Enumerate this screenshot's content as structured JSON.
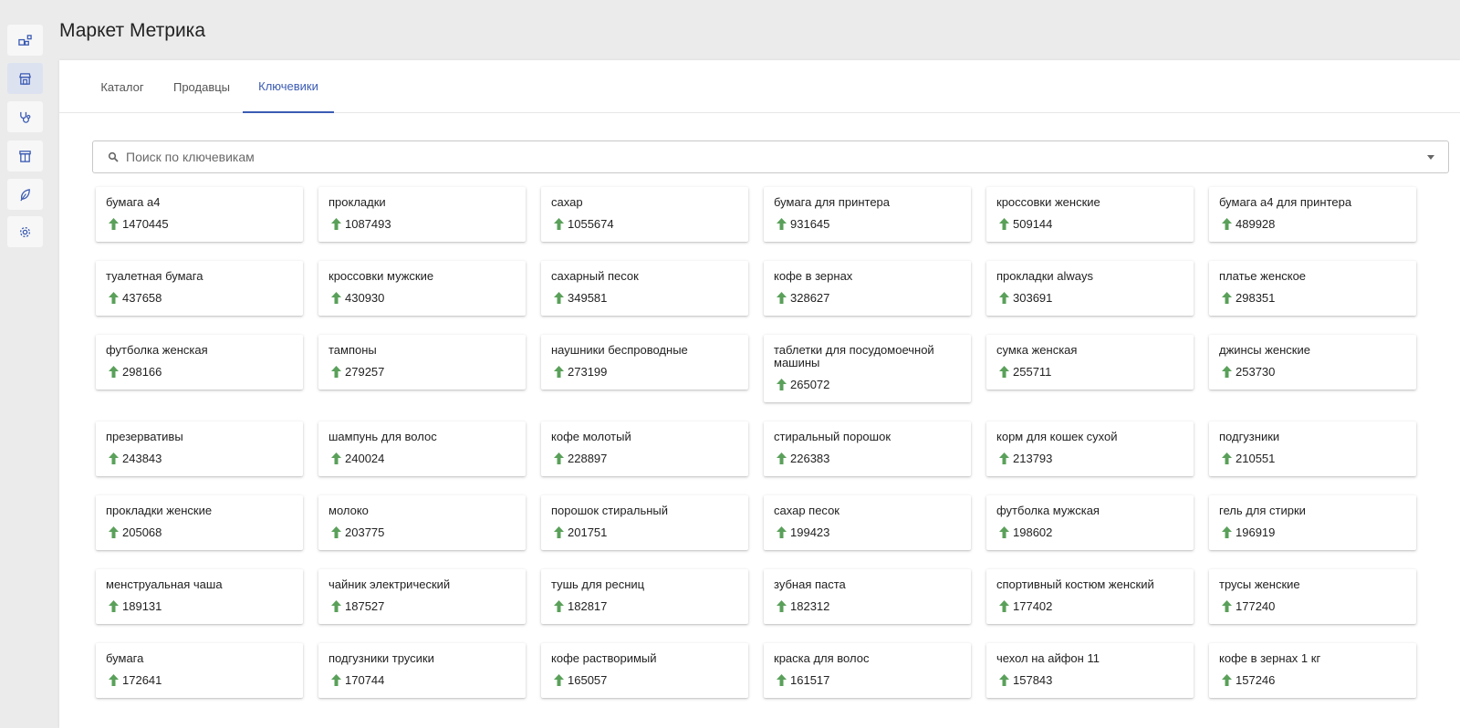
{
  "app": {
    "title": "Маркет Метрика"
  },
  "sidebar": {
    "items": [
      {
        "icon": "shapes-icon",
        "active": false
      },
      {
        "icon": "store-icon",
        "active": true
      },
      {
        "icon": "stethoscope-icon",
        "active": false
      },
      {
        "icon": "shop-icon",
        "active": false
      },
      {
        "icon": "leaf-icon",
        "active": false
      },
      {
        "icon": "gear-icon",
        "active": false
      }
    ]
  },
  "tabs": [
    {
      "label": "Каталог",
      "active": false
    },
    {
      "label": "Продавцы",
      "active": false
    },
    {
      "label": "Ключевики",
      "active": true
    }
  ],
  "search": {
    "placeholder": "Поиск по ключевикам",
    "value": ""
  },
  "colors": {
    "accent": "#3b5bb3",
    "trend_up": "#5aa05a"
  },
  "keywords": [
    {
      "name": "бумага а4",
      "count": "1470445"
    },
    {
      "name": "прокладки",
      "count": "1087493"
    },
    {
      "name": "сахар",
      "count": "1055674"
    },
    {
      "name": "бумага для принтера",
      "count": "931645"
    },
    {
      "name": "кроссовки женские",
      "count": "509144"
    },
    {
      "name": "бумага а4 для принтера",
      "count": "489928"
    },
    {
      "name": "туалетная бумага",
      "count": "437658"
    },
    {
      "name": "кроссовки мужские",
      "count": "430930"
    },
    {
      "name": "сахарный песок",
      "count": "349581"
    },
    {
      "name": "кофе в зернах",
      "count": "328627"
    },
    {
      "name": "прокладки always",
      "count": "303691"
    },
    {
      "name": "платье женское",
      "count": "298351"
    },
    {
      "name": "футболка женская",
      "count": "298166"
    },
    {
      "name": "тампоны",
      "count": "279257"
    },
    {
      "name": "наушники беспроводные",
      "count": "273199"
    },
    {
      "name": "таблетки для посудомоечной машины",
      "count": "265072"
    },
    {
      "name": "сумка женская",
      "count": "255711"
    },
    {
      "name": "джинсы женские",
      "count": "253730"
    },
    {
      "name": "презервативы",
      "count": "243843"
    },
    {
      "name": "шампунь для волос",
      "count": "240024"
    },
    {
      "name": "кофе молотый",
      "count": "228897"
    },
    {
      "name": "стиральный порошок",
      "count": "226383"
    },
    {
      "name": "корм для кошек сухой",
      "count": "213793"
    },
    {
      "name": "подгузники",
      "count": "210551"
    },
    {
      "name": "прокладки женские",
      "count": "205068"
    },
    {
      "name": "молоко",
      "count": "203775"
    },
    {
      "name": "порошок стиральный",
      "count": "201751"
    },
    {
      "name": "сахар песок",
      "count": "199423"
    },
    {
      "name": "футболка мужская",
      "count": "198602"
    },
    {
      "name": "гель для стирки",
      "count": "196919"
    },
    {
      "name": "менструальная чаша",
      "count": "189131"
    },
    {
      "name": "чайник электрический",
      "count": "187527"
    },
    {
      "name": "тушь для ресниц",
      "count": "182817"
    },
    {
      "name": "зубная паста",
      "count": "182312"
    },
    {
      "name": "спортивный костюм женский",
      "count": "177402"
    },
    {
      "name": "трусы женские",
      "count": "177240"
    },
    {
      "name": "бумага",
      "count": "172641"
    },
    {
      "name": "подгузники трусики",
      "count": "170744"
    },
    {
      "name": "кофе растворимый",
      "count": "165057"
    },
    {
      "name": "краска для волос",
      "count": "161517"
    },
    {
      "name": "чехол на айфон 11",
      "count": "157843"
    },
    {
      "name": "кофе в зернах 1 кг",
      "count": "157246"
    }
  ]
}
